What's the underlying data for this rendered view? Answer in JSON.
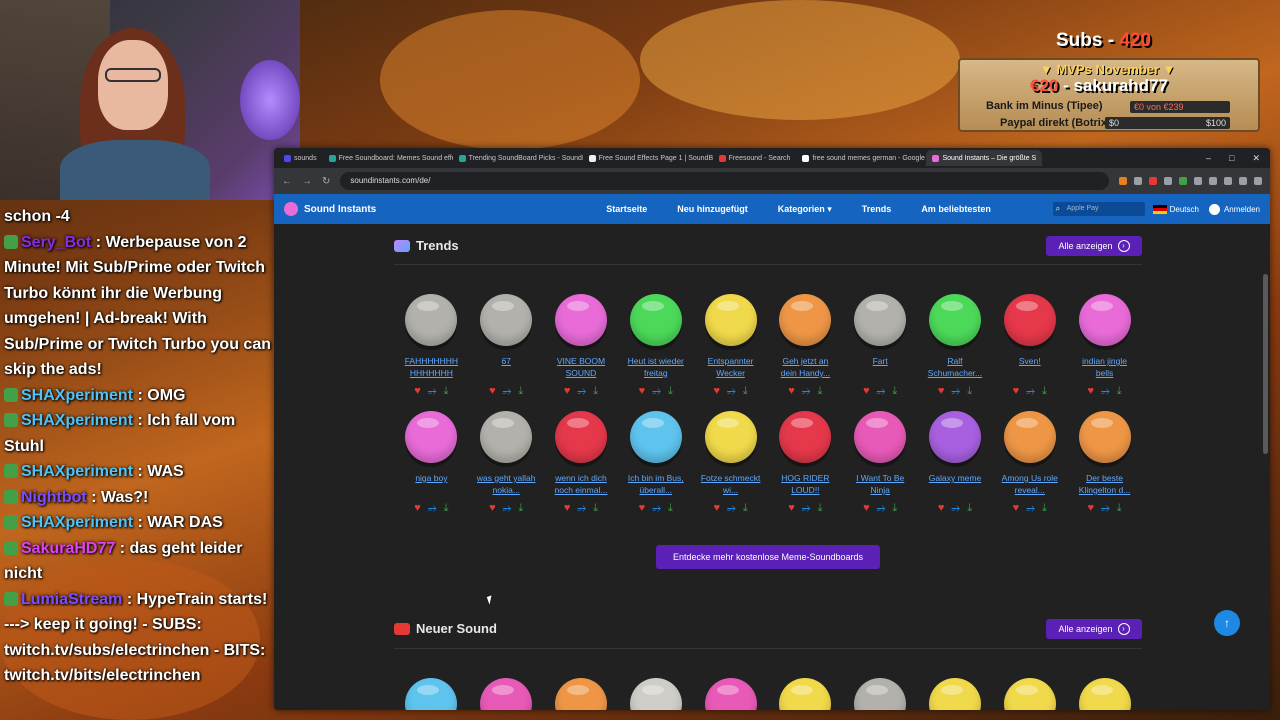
{
  "overlay": {
    "subs_label": "Subs - ",
    "subs_count": "420",
    "mvp_title": "▼ MVPs November ▼",
    "top_amount": "€20",
    "top_user": " - sakurahd77",
    "row1_label": "Bank im Minus (Tipee)",
    "row1_bar": "€0 von €239",
    "row2_label": "Paypal direkt (Botrix)",
    "row2_left": "$0",
    "row2_right": "$100"
  },
  "chat": [
    {
      "user": "",
      "user_color": "#ffffff",
      "text": "schon -4"
    },
    {
      "user": "Sery_Bot",
      "user_color": "#8a2be2",
      "text": " : Werbepause von 2 Minute! Mit Sub/Prime oder Twitch Turbo könnt ihr die Werbung umgehen! | Ad-break! With Sub/Prime or Twitch Turbo you can skip the ads!"
    },
    {
      "user": "SHAXperiment",
      "user_color": "#4fc3f7",
      "text": " : OMG"
    },
    {
      "user": "SHAXperiment",
      "user_color": "#4fc3f7",
      "text": " : Ich fall vom Stuhl"
    },
    {
      "user": "SHAXperiment",
      "user_color": "#4fc3f7",
      "text": " : WAS"
    },
    {
      "user": "Nightbot",
      "user_color": "#7c4dff",
      "text": " : Was?!"
    },
    {
      "user": "SHAXperiment",
      "user_color": "#4fc3f7",
      "text": " : WAR DAS"
    },
    {
      "user": "SakuraHD77",
      "user_color": "#e040fb",
      "text": " : das geht leider nicht"
    },
    {
      "user": "LumiaStream",
      "user_color": "#7c4dff",
      "text": " : HypeTrain starts! ---> keep it going! - SUBS: twitch.tv/subs/electrinchen - BITS: twitch.tv/bits/electrinchen"
    }
  ],
  "browser": {
    "tabs": [
      {
        "label": "sounds",
        "color": "#4a4af0",
        "active": false
      },
      {
        "label": "Free Soundboard: Memes Sound effec",
        "color": "#26a69a",
        "active": false
      },
      {
        "label": "Trending SoundBoard Picks - SoundB",
        "color": "#26a69a",
        "active": false
      },
      {
        "label": "Free Sound Effects Page 1 | SoundBib",
        "color": "#eeeeee",
        "active": false
      },
      {
        "label": "Freesound - Search",
        "color": "#e53935",
        "active": false
      },
      {
        "label": "free sound memes german - Google S",
        "color": "#ffffff",
        "active": false
      },
      {
        "label": "Sound Instants – Die größte S",
        "color": "#e86bd8",
        "active": true
      }
    ],
    "url": "soundinstants.com/de/"
  },
  "site": {
    "brand": "Sound Instants",
    "menu": [
      "Startseite",
      "Neu hinzugefügt",
      "Kategorien ▾",
      "Trends",
      "Am beliebtesten"
    ],
    "search_placeholder": "Apple Pay",
    "language": "Deutsch",
    "login": "Anmelden",
    "trends_title": "Trends",
    "new_title": "Neuer Sound",
    "all_label": "Alle anzeigen",
    "discover_label": "Entdecke mehr kostenlose Meme-Soundboards",
    "trends": [
      {
        "label": "FAHHHHHHH HHHHHHH",
        "color": "#b3b1ab"
      },
      {
        "label": "67",
        "color": "#b3b1ab"
      },
      {
        "label": "VINE BOOM SOUND",
        "color": "#e86bd8"
      },
      {
        "label": "Heut ist wieder freitag",
        "color": "#4cd95a"
      },
      {
        "label": "Entspannter Wecker",
        "color": "#f0d94a"
      },
      {
        "label": "Geh jetzt an dein Handy...",
        "color": "#ee9646"
      },
      {
        "label": "Fart",
        "color": "#b3b1ab"
      },
      {
        "label": "Ralf Schumacher...",
        "color": "#4cd95a"
      },
      {
        "label": "Sven!",
        "color": "#e5384a"
      },
      {
        "label": "indian jingle bells",
        "color": "#e86bd8"
      },
      {
        "label": "niga boy",
        "color": "#e86bd8"
      },
      {
        "label": "was geht yallah nokia...",
        "color": "#b3b1ab"
      },
      {
        "label": "wenn ich dich noch einmal...",
        "color": "#e5384a"
      },
      {
        "label": "Ich bin im Bus, überall...",
        "color": "#5ec4ee"
      },
      {
        "label": "Fotze schmeckt wi...",
        "color": "#f0d94a"
      },
      {
        "label": "HOG RIDER LOUD!!",
        "color": "#e5384a"
      },
      {
        "label": "I Want To Be Ninja",
        "color": "#e85ab8"
      },
      {
        "label": "Galaxy meme",
        "color": "#a860e0"
      },
      {
        "label": "Among Us role reveal...",
        "color": "#ee9646"
      },
      {
        "label": "Der beste Klingelton d...",
        "color": "#ee9646"
      }
    ],
    "new_sounds": [
      {
        "color": "#5ec4ee"
      },
      {
        "color": "#e85ab8"
      },
      {
        "color": "#ee9646"
      },
      {
        "color": "#cfcdc8"
      },
      {
        "color": "#e85ab8"
      },
      {
        "color": "#f0d94a"
      },
      {
        "color": "#b3b1ab"
      },
      {
        "color": "#f0d94a"
      },
      {
        "color": "#f0d94a"
      },
      {
        "color": "#f0d94a"
      }
    ]
  }
}
